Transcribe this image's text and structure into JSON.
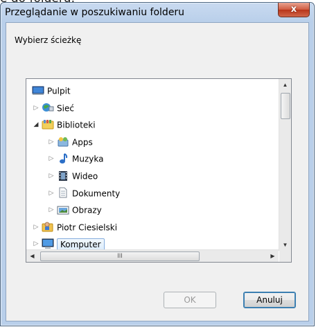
{
  "backdrop": {
    "text": "ę do folderu."
  },
  "window": {
    "title": "Przeglądanie w poszukiwaniu folderu",
    "close_label": "x"
  },
  "prompt": "Wybierz ścieżkę",
  "tree": {
    "items": [
      {
        "label": "Pulpit",
        "icon": "desktop-icon",
        "level": 0,
        "expander": "none"
      },
      {
        "label": "Sieć",
        "icon": "network-icon",
        "level": 1,
        "expander": "collapsed"
      },
      {
        "label": "Biblioteki",
        "icon": "libraries-icon",
        "level": 1,
        "expander": "expanded"
      },
      {
        "label": "Apps",
        "icon": "apps-library-icon",
        "level": 2,
        "expander": "collapsed"
      },
      {
        "label": "Muzyka",
        "icon": "music-icon",
        "level": 2,
        "expander": "collapsed"
      },
      {
        "label": "Wideo",
        "icon": "video-icon",
        "level": 2,
        "expander": "collapsed"
      },
      {
        "label": "Dokumenty",
        "icon": "documents-icon",
        "level": 2,
        "expander": "collapsed"
      },
      {
        "label": "Obrazy",
        "icon": "pictures-icon",
        "level": 2,
        "expander": "collapsed"
      },
      {
        "label": "Piotr Ciesielski",
        "icon": "user-folder-icon",
        "level": 1,
        "expander": "collapsed"
      },
      {
        "label": "Komputer",
        "icon": "computer-icon",
        "level": 1,
        "expander": "collapsed",
        "selected": true
      }
    ],
    "hscroll_grip": "III"
  },
  "buttons": {
    "ok_label": "OK",
    "cancel_label": "Anuluj"
  }
}
